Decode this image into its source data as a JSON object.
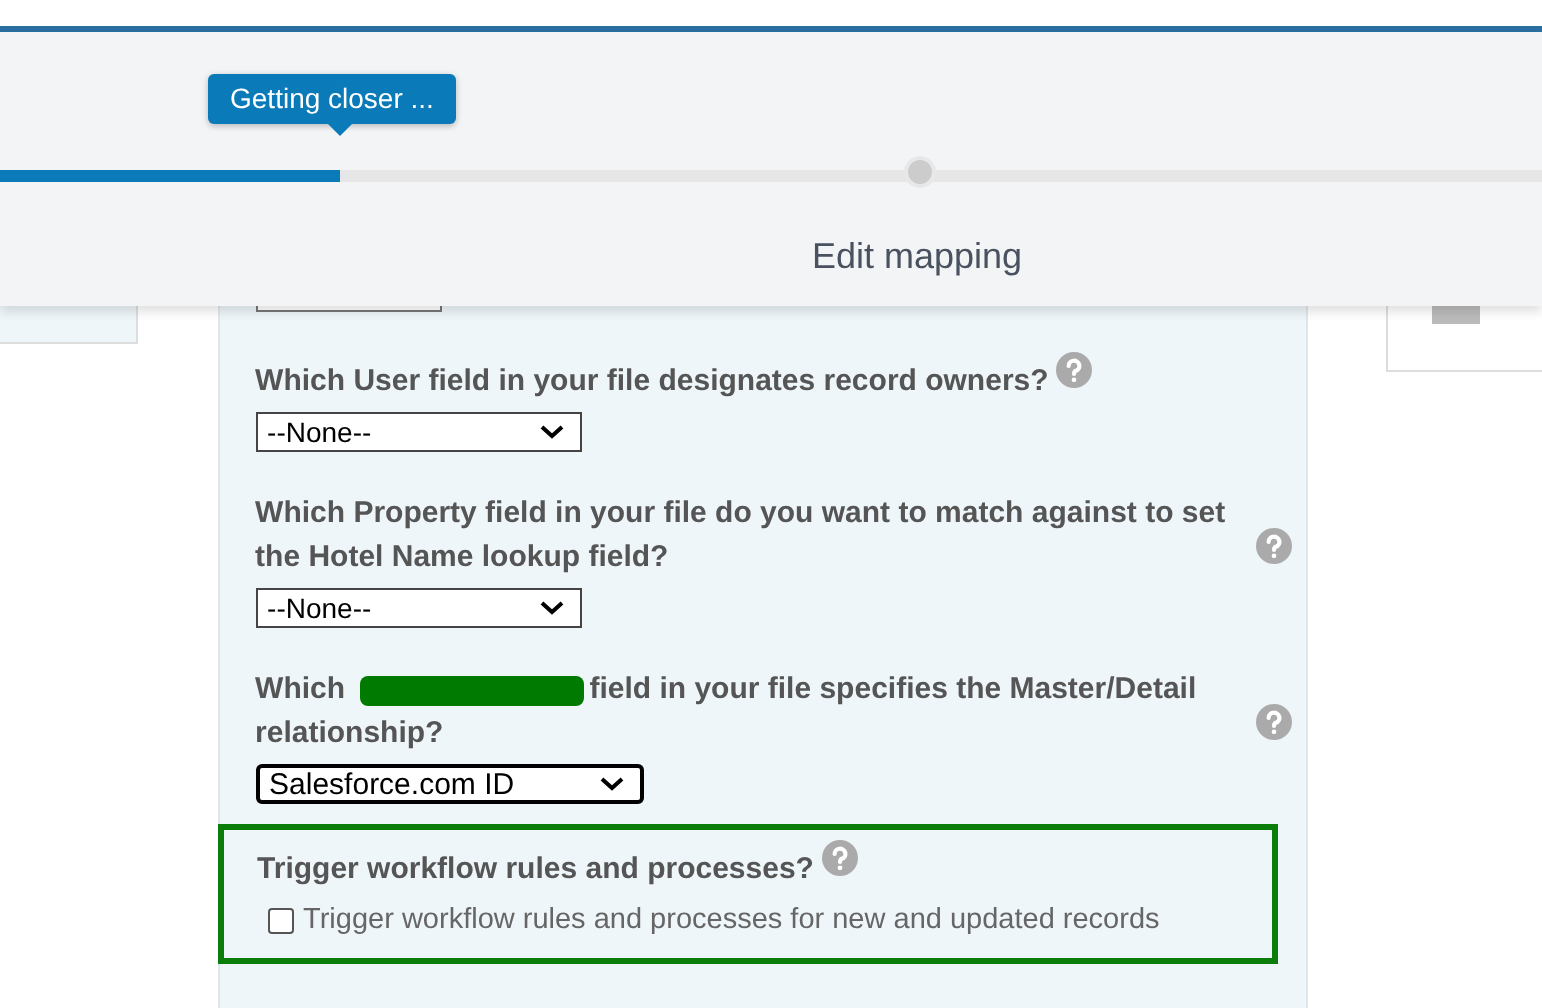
{
  "progress": {
    "tooltip": "Getting closer ...",
    "level": 0.22,
    "step": {
      "label": "Edit mapping",
      "done": false
    }
  },
  "questions": [
    {
      "kind": "cut",
      "value_visible": false
    },
    {
      "kind": "select",
      "label": "Which User field in your file designates record owners?",
      "value": "--None--",
      "focused": false,
      "help": true
    },
    {
      "kind": "select",
      "label": "Which Property field in your file do you want to match against to set the Hotel Name lookup field?",
      "value": "--None--",
      "focused": false,
      "help": true
    },
    {
      "kind": "select",
      "label_parts": [
        "Which",
        "field in your file specifies the Master/Detail relationship?"
      ],
      "redacted": true,
      "value": "Salesforce.com ID",
      "focused": true,
      "help": true
    }
  ],
  "workflow": {
    "title": "Trigger workflow rules and processes?",
    "highlighted": true,
    "help": true,
    "checkbox": {
      "label": "Trigger workflow rules and processes for new and updated records",
      "checked": false
    }
  }
}
